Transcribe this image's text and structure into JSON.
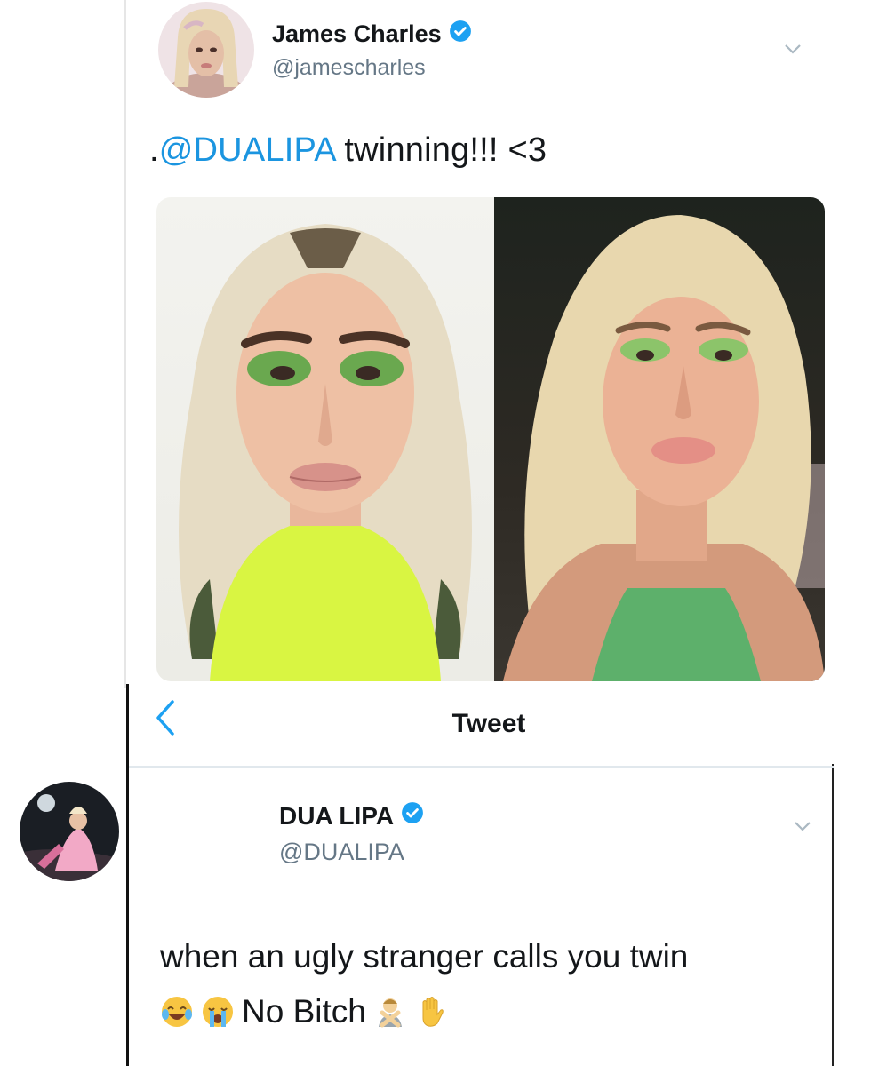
{
  "tweet1": {
    "name": "James Charles",
    "handle": "@jamescharles",
    "verified": true,
    "text_prefix": ".",
    "mention": "@DUALIPA",
    "text_rest": " twinning!!! <3",
    "photos": [
      "photo-james-charles",
      "photo-dua-lipa"
    ]
  },
  "nav": {
    "back_icon": "chevron-left-icon",
    "title": "Tweet"
  },
  "tweet2": {
    "name": "DUA LIPA",
    "handle": "@DUALIPA",
    "verified": true,
    "line1": "when an ugly stranger calls you twin",
    "line2_text": "No Bitch",
    "emojis_before": [
      "face-with-tears-of-joy",
      "loudly-crying-face"
    ],
    "emojis_after": [
      "person-gesturing-no",
      "raised-hand"
    ]
  },
  "colors": {
    "accent": "#1da1f2",
    "mention": "#1b95e0",
    "text": "#14171a",
    "secondary": "#657786",
    "verified": "#1da1f2"
  }
}
